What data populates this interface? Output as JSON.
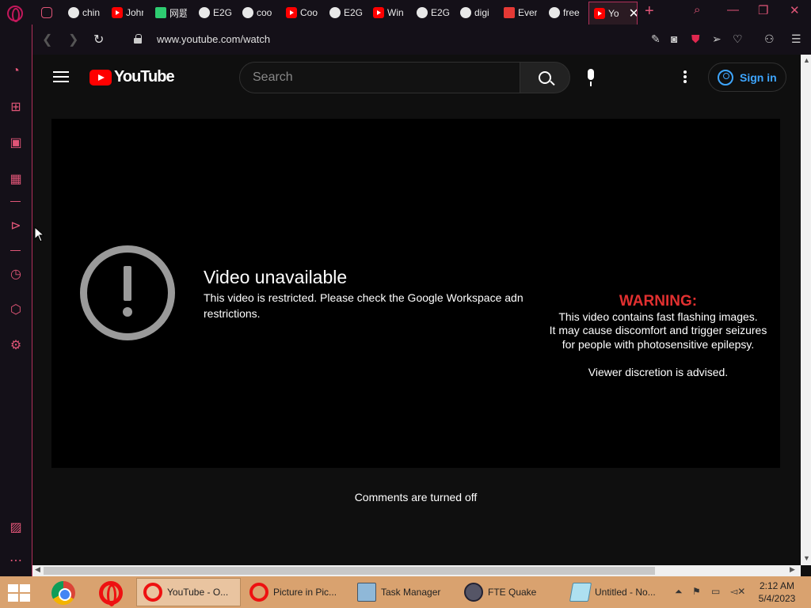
{
  "browser": {
    "tabs": [
      {
        "label": "",
        "icon": "gamepad-icon"
      },
      {
        "label": "chin",
        "icon": "globe-icon"
      },
      {
        "label": "Johr",
        "icon": "youtube-icon"
      },
      {
        "label": "网题",
        "icon": "share-icon"
      },
      {
        "label": "E2G",
        "icon": "github-icon"
      },
      {
        "label": "coo",
        "icon": "globe-icon"
      },
      {
        "label": "Coo",
        "icon": "youtube-icon"
      },
      {
        "label": "E2G",
        "icon": "globe-icon"
      },
      {
        "label": "Win",
        "icon": "youtube-icon"
      },
      {
        "label": "E2G",
        "icon": "globe-icon"
      },
      {
        "label": "digi",
        "icon": "globe-icon"
      },
      {
        "label": "Ever",
        "icon": "tv-icon"
      },
      {
        "label": "free",
        "icon": "globe-icon"
      },
      {
        "label": "Yo",
        "icon": "youtube-icon",
        "active": true
      }
    ],
    "url": "www.youtube.com/watch",
    "accent_color": "#e05577"
  },
  "youtube": {
    "logo_text": "YouTube",
    "search_placeholder": "Search",
    "sign_in_label": "Sign in",
    "player": {
      "unavailable_title": "Video unavailable",
      "unavailable_message": "This video is restricted. Please check the Google Workspace adn restrictions.",
      "warning": {
        "title": "WARNING:",
        "line1": "This video contains fast flashing images.",
        "line2": "It may cause discomfort and trigger seizures",
        "line3": "for people with photosensitive epilepsy.",
        "advisory": "Viewer discretion is advised."
      }
    },
    "comments_status": "Comments are turned off"
  },
  "taskbar": {
    "tasks": [
      {
        "label": "YouTube - O...",
        "icon": "opera-icon",
        "active": true
      },
      {
        "label": "Picture in Pic...",
        "icon": "opera-icon"
      },
      {
        "label": "Task Manager",
        "icon": "task-manager-icon"
      },
      {
        "label": "FTE Quake",
        "icon": "quake-icon"
      },
      {
        "label": "Untitled - No...",
        "icon": "notepad-icon"
      }
    ],
    "time": "2:12 AM",
    "date": "5/4/2023"
  }
}
